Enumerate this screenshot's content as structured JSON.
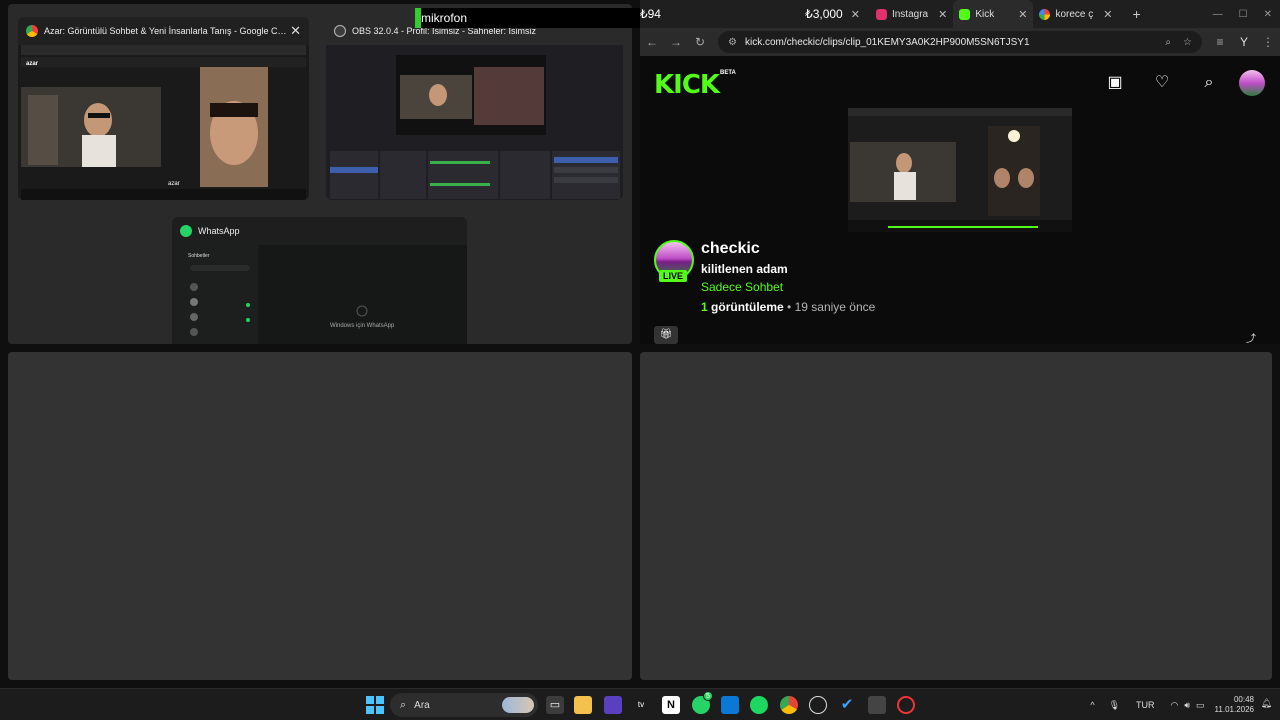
{
  "overlay": {
    "mic_label": "mikrofon",
    "price_left": "₺94",
    "price_right": "₺3,000"
  },
  "windows": {
    "azar": {
      "title": "Azar: Görüntülü Sohbet & Yeni İnsanlarla Tanış - Google Chrome",
      "brand": "azar"
    },
    "obs": {
      "title": "OBS 32.0.4 - Profil: İsimsiz - Sahneler: İsimsiz"
    },
    "whatsapp": {
      "title": "WhatsApp",
      "chats_header": "Sohbetler",
      "center_text": "Windows için WhatsApp"
    }
  },
  "chrome": {
    "tabs": [
      {
        "label": "Instagra",
        "icon": "instagram-icon",
        "color": "#e1306c"
      },
      {
        "label": "Kick",
        "icon": "kick-icon",
        "color": "#53fc18"
      },
      {
        "label": "korece ç",
        "icon": "google-icon",
        "color": "#4285f4"
      }
    ],
    "url": "kick.com/checkic/clips/clip_01KEMY3A0K2HP900M5SN6TJSY1"
  },
  "kick": {
    "logo": "KICK",
    "beta": "BETA",
    "channel": "checkic",
    "live": "LIVE",
    "clip_title": "kilitlenen adam",
    "category": "Sadece Sohbet",
    "views_count": "1",
    "views_label": "görüntüleme",
    "time": "• 19 saniye önce",
    "accent": "#53fc18"
  },
  "taskbar": {
    "search_placeholder": "Ara",
    "language": "TUR",
    "time": "00:48",
    "date": "11.01.2026",
    "whatsapp_badge": "5"
  }
}
